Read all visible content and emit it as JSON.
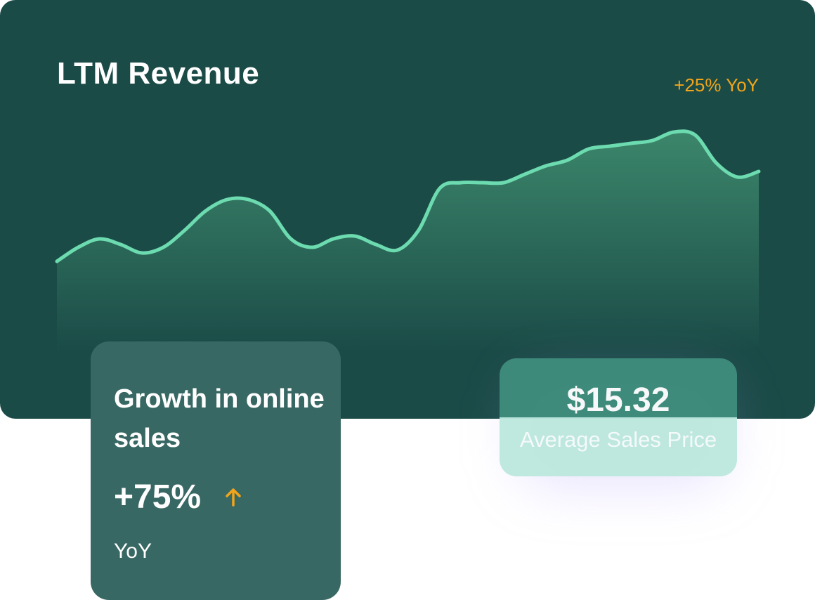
{
  "chart_data": {
    "type": "area",
    "title": "LTM Revenue",
    "badge": "+25% YoY",
    "x": [
      0,
      1,
      2,
      3,
      4,
      5,
      6,
      7,
      8,
      9,
      10,
      11,
      12,
      13,
      14,
      15,
      16,
      17,
      18,
      19,
      20,
      21,
      22,
      23,
      24,
      25,
      26,
      27,
      28,
      29,
      30,
      31,
      32,
      33,
      34,
      35,
      36,
      37,
      38,
      39,
      40
    ],
    "values": [
      32,
      37,
      40,
      38,
      35,
      37,
      43,
      50,
      54,
      54,
      50,
      40,
      37,
      40,
      41,
      38,
      36,
      43,
      58,
      60,
      60,
      60,
      63,
      66,
      68,
      72,
      73,
      74,
      75,
      78,
      77,
      67,
      62,
      64
    ],
    "ylim": [
      0,
      100
    ],
    "line_color": "#6ddbb0",
    "fill_color": "#3f8d6f",
    "grid": false,
    "legend": "none"
  },
  "growth": {
    "title": "Growth in online sales",
    "value": "+75%",
    "period": "YoY",
    "arrow_icon": "arrow-up-icon",
    "arrow_color": "#f2a51a"
  },
  "price": {
    "value": "$15.32",
    "label": "Average Sales Price"
  },
  "colors": {
    "card_bg": "#1b4b47",
    "accent": "#f2a51a",
    "growth_card_bg": "#386863",
    "price_card_top": "#3f8d7c",
    "price_card_bottom": "#bde8dd"
  }
}
